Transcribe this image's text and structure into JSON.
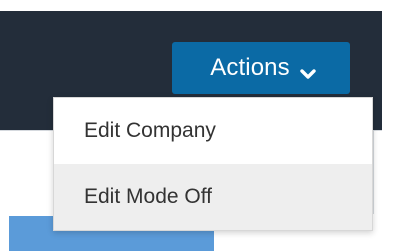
{
  "header": {
    "actions_button": {
      "label": "Actions",
      "icon": "chevron-down-icon"
    }
  },
  "actions_menu": {
    "items": [
      {
        "label": "Edit Company"
      },
      {
        "label": "Edit Mode Off",
        "highlighted": true
      }
    ]
  },
  "colors": {
    "header_bg": "#232d3a",
    "button_bg": "#0b6aa5",
    "panel_blue": "#5b9bd9"
  }
}
